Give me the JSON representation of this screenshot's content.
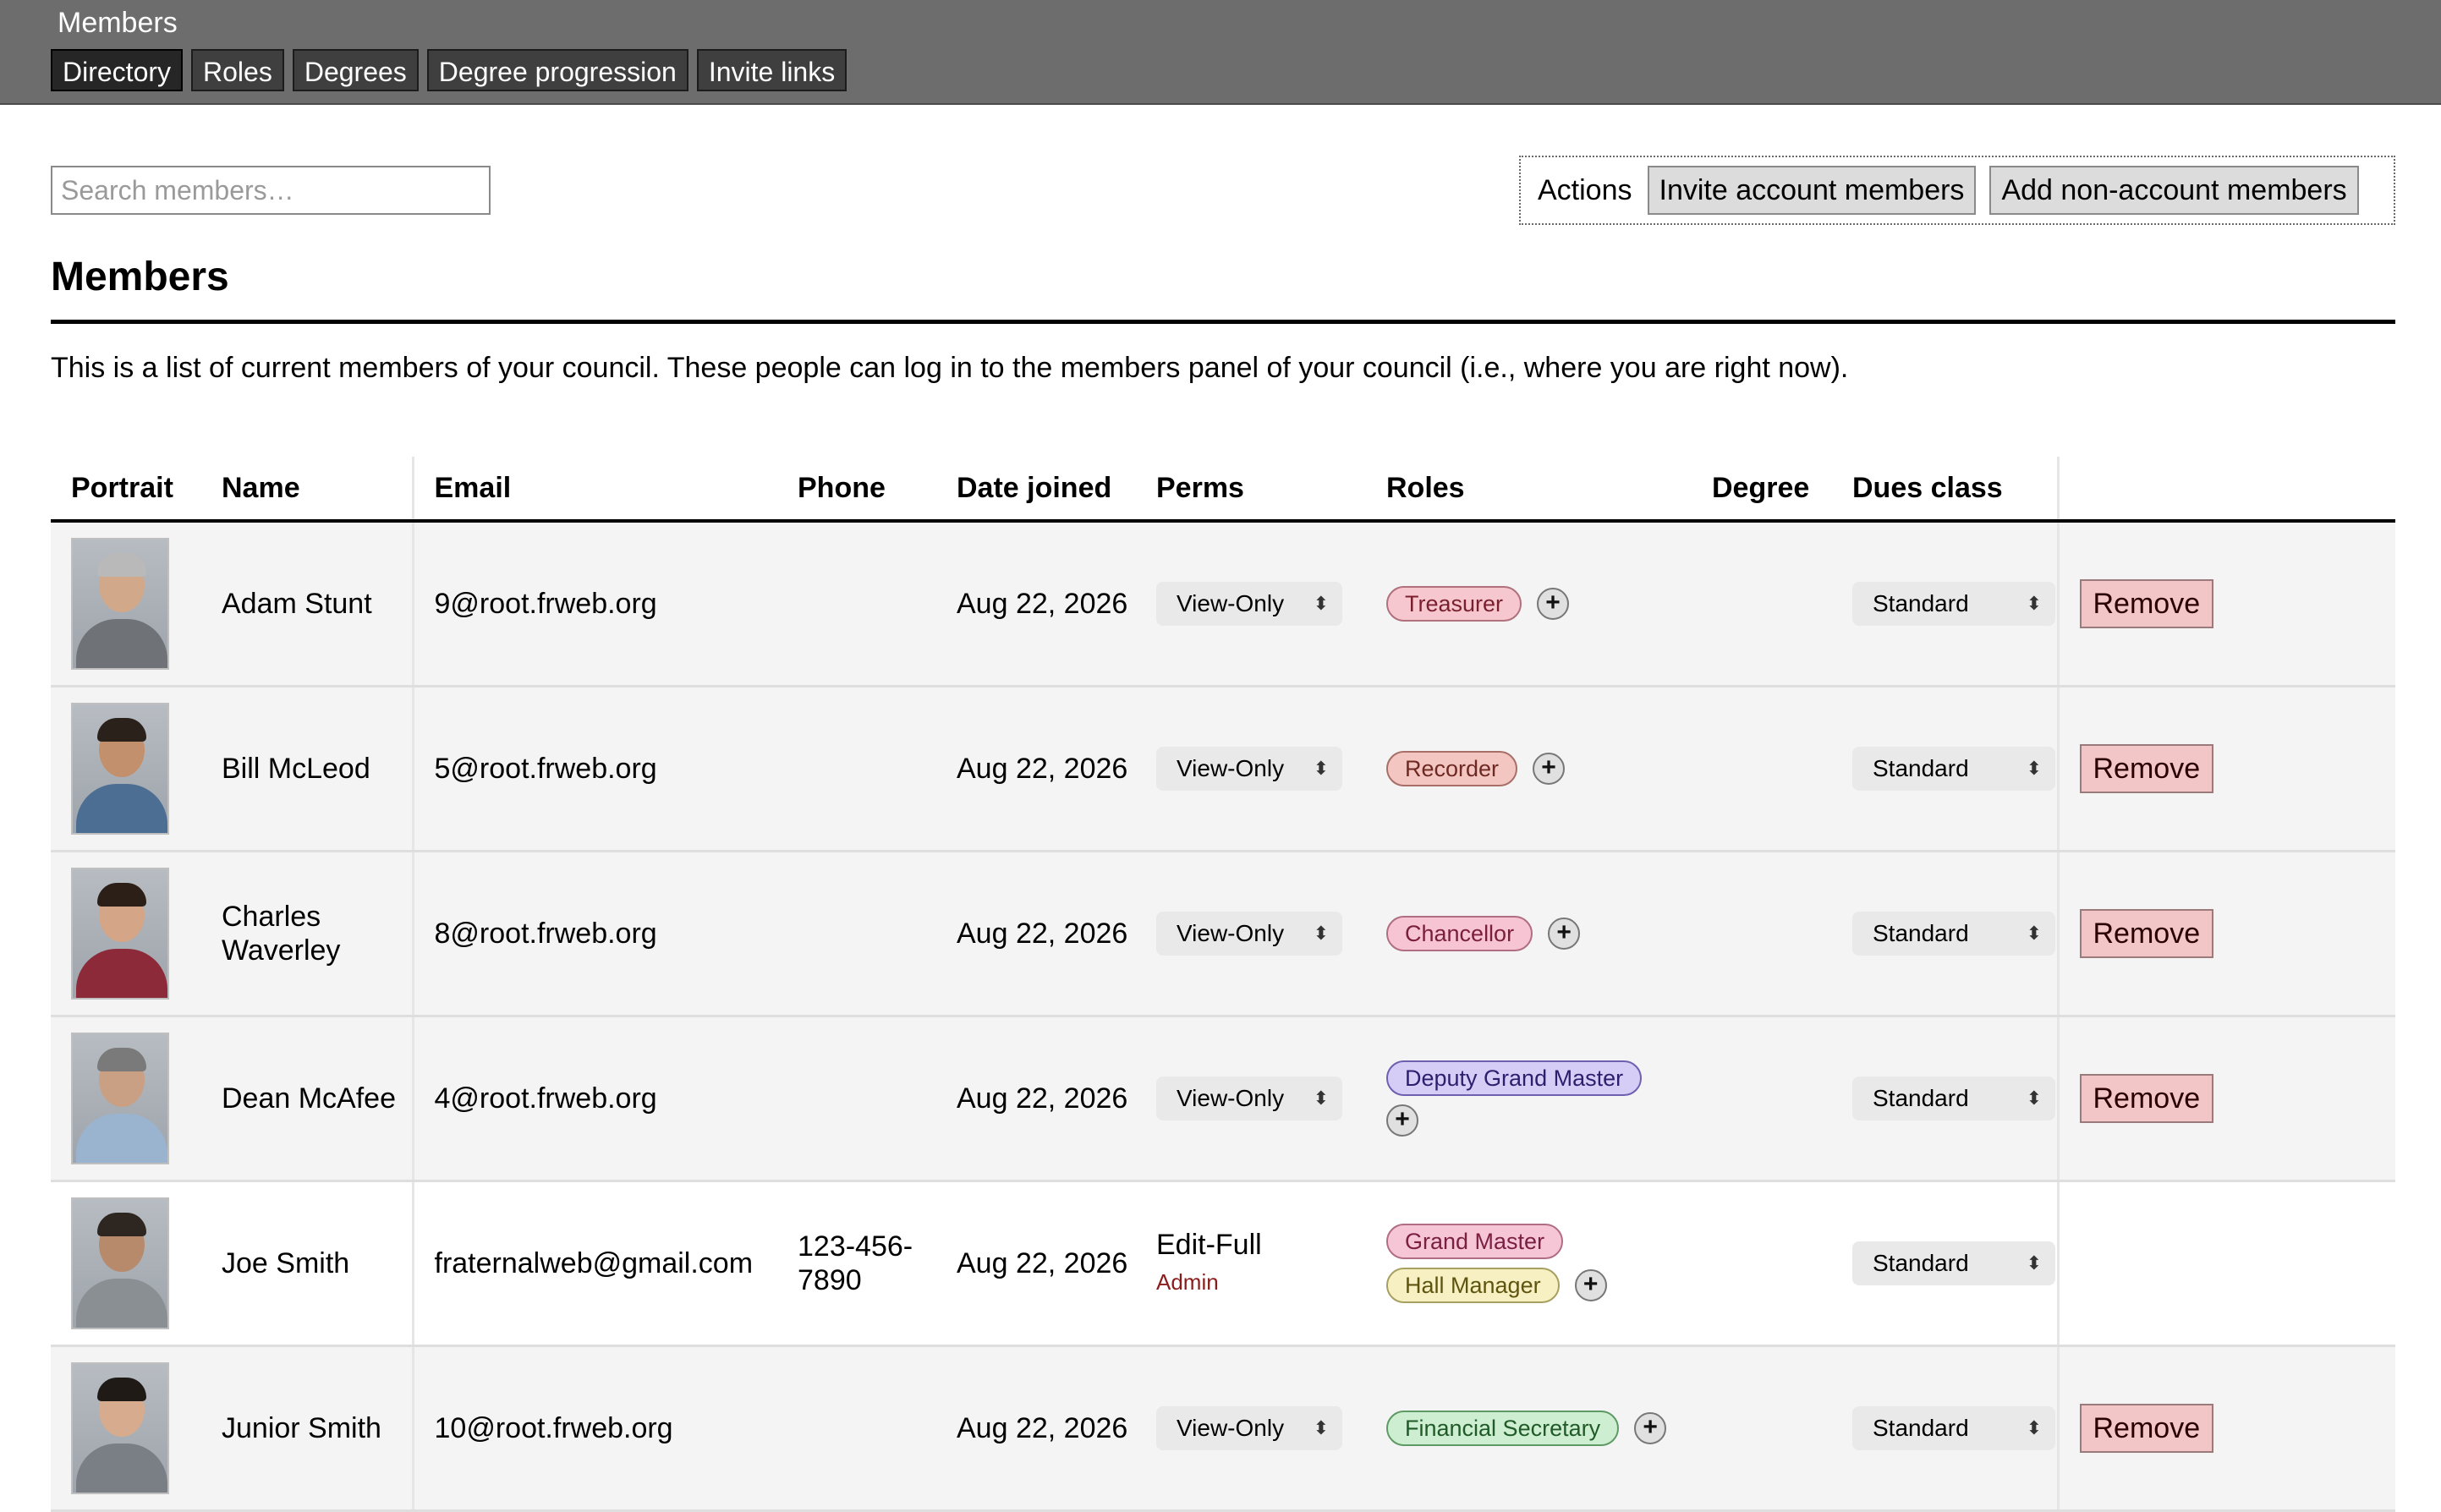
{
  "app": {
    "title": "Members",
    "tabs": [
      {
        "label": "Directory",
        "active": true
      },
      {
        "label": "Roles"
      },
      {
        "label": "Degrees"
      },
      {
        "label": "Degree progression"
      },
      {
        "label": "Invite links"
      }
    ]
  },
  "search": {
    "placeholder": "Search members…"
  },
  "actions": {
    "label": "Actions",
    "invite_label": "Invite account members",
    "add_label": "Add non-account members"
  },
  "section": {
    "title": "Members",
    "description": "This is a list of current members of your council. These people can log in to the members panel of your council (i.e., where you are right now)."
  },
  "table": {
    "headers": {
      "portrait": "Portrait",
      "name": "Name",
      "email": "Email",
      "phone": "Phone",
      "date_joined": "Date joined",
      "perms": "Perms",
      "roles": "Roles",
      "degree": "Degree",
      "dues_class": "Dues class"
    },
    "rows": [
      {
        "name": "Adam Stunt",
        "email": "9@root.frweb.org",
        "phone": "",
        "date": "Aug 22, 2026",
        "perm": "View-Only",
        "dues": "Standard",
        "roles": [
          {
            "label": "Treasurer",
            "color": "#f6c7cf"
          }
        ],
        "remove": "Remove"
      },
      {
        "name": "Bill McLeod",
        "email": "5@root.frweb.org",
        "phone": "",
        "date": "Aug 22, 2026",
        "perm": "View-Only",
        "dues": "Standard",
        "roles": [
          {
            "label": "Recorder",
            "color": "#f4c6c2"
          }
        ],
        "remove": "Remove"
      },
      {
        "name": "Charles Waverley",
        "email": "8@root.frweb.org",
        "phone": "",
        "date": "Aug 22, 2026",
        "perm": "View-Only",
        "dues": "Standard",
        "roles": [
          {
            "label": "Chancellor",
            "color": "#f6c4d3"
          }
        ],
        "remove": "Remove"
      },
      {
        "name": "Dean McAfee",
        "email": "4@root.frweb.org",
        "phone": "",
        "date": "Aug 22, 2026",
        "perm": "View-Only",
        "dues": "Standard",
        "roles": [
          {
            "label": "Deputy Grand Master",
            "color": "#d6cdf6"
          }
        ],
        "remove": "Remove"
      },
      {
        "name": "Joe Smith",
        "email": "fraternalweb@gmail.com",
        "phone": "123-456-7890",
        "date": "Aug 22, 2026",
        "perm_text": "Edit-Full",
        "perm_sub": "Admin",
        "dues": "Standard",
        "roles": [
          {
            "label": "Grand Master",
            "color": "#f6c6d6"
          },
          {
            "label": "Hall Manager",
            "color": "#f6f0c2"
          }
        ],
        "remove": ""
      },
      {
        "name": "Junior Smith",
        "email": "10@root.frweb.org",
        "phone": "",
        "date": "Aug 22, 2026",
        "perm": "View-Only",
        "dues": "Standard",
        "roles": [
          {
            "label": "Financial Secretary",
            "color": "#cdeed0"
          }
        ],
        "remove": "Remove"
      }
    ]
  },
  "icons": {
    "add_role": "plus-icon",
    "select_chevron": "updown-chevron-icon"
  }
}
